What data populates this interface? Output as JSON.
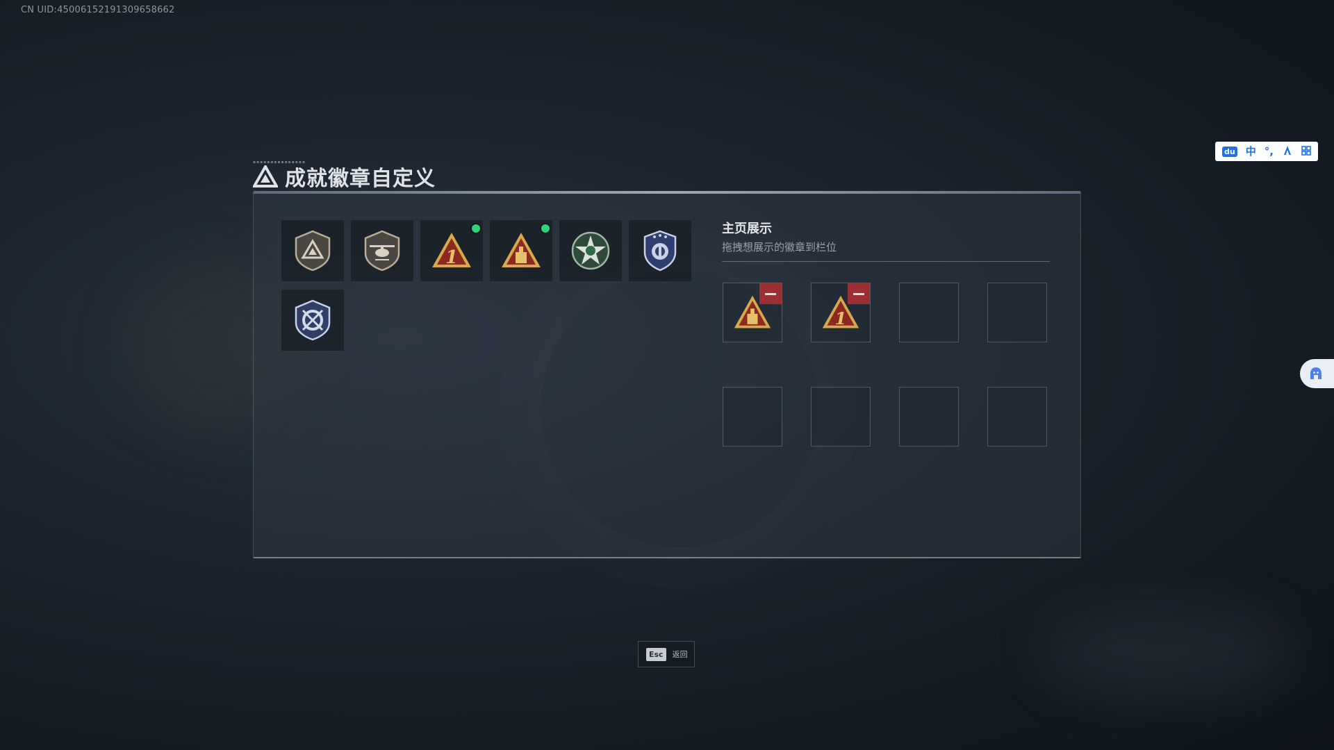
{
  "uid_text": "CN UID:450061521913096586​62",
  "title": "成就徽章自定义",
  "ime_toolbar": {
    "items": [
      "du",
      "中",
      "°,",
      "person-icon",
      "grid-icon"
    ]
  },
  "badges": [
    {
      "name": "shield-triangle-badge",
      "new": false
    },
    {
      "name": "helicopter-shield-badge",
      "new": false
    },
    {
      "name": "triangle-number-one-badge",
      "new": true
    },
    {
      "name": "triangle-tower-badge",
      "new": true
    },
    {
      "name": "green-star-wreath-badge",
      "new": false
    },
    {
      "name": "navy-crest-badge",
      "new": false
    },
    {
      "name": "crossed-rifles-shield-badge",
      "new": false
    }
  ],
  "showcase": {
    "title": "主页展示",
    "subtitle": "拖拽想展示的徽章到栏位",
    "slots": [
      "triangle-tower-badge",
      "triangle-number-one-badge",
      "",
      "",
      "",
      "",
      "",
      ""
    ]
  },
  "footer": {
    "key": "Esc",
    "label": "返回"
  },
  "colors": {
    "accent_new": "#2fd17a",
    "remove": "#9b2f31",
    "badge_gold": "#d8a94a",
    "badge_red": "#8c2a22"
  }
}
